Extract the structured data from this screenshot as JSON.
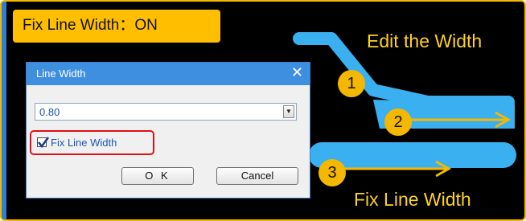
{
  "header": {
    "title": "Fix Line Width：ON"
  },
  "dialog": {
    "title": "Line Width",
    "close_glyph": "✕",
    "width_value": "0.80",
    "dropdown_glyph": "▼",
    "fix_line_width_label": "Fix Line Width",
    "fix_line_width_checked": true,
    "ok_label": "O K",
    "cancel_label": "Cancel"
  },
  "annotations": {
    "edit_caption": "Edit the Width",
    "fix_caption": "Fix Line Width",
    "badges": [
      "1",
      "2",
      "3"
    ]
  },
  "colors": {
    "frame_border": "#f5b800",
    "line_blue": "#3ab0f0",
    "arrow_orange": "#f5b800",
    "caption_yellow": "#ffd21f",
    "highlight_red": "#e0101a"
  }
}
